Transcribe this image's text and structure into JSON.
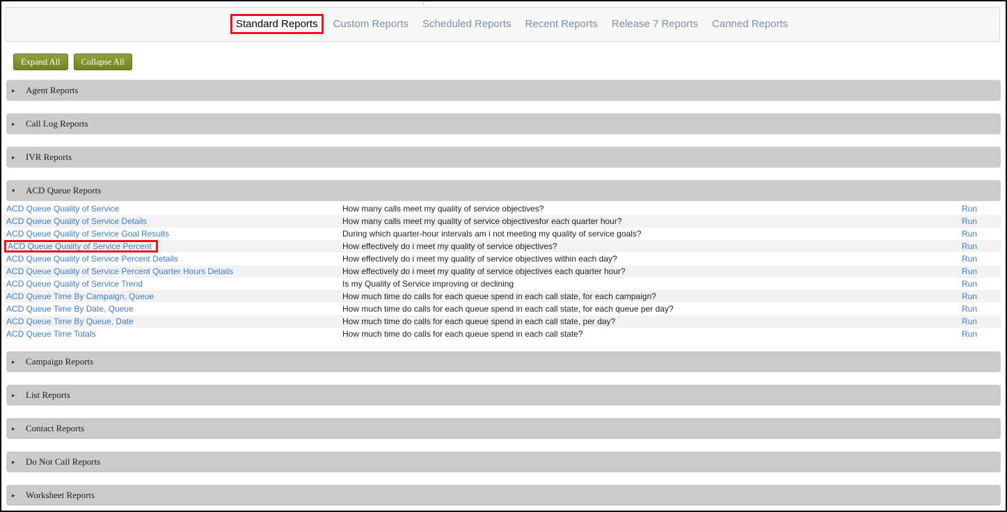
{
  "tabs": {
    "standard": "Standard Reports",
    "custom": "Custom Reports",
    "scheduled": "Scheduled Reports",
    "recent": "Recent Reports",
    "release7": "Release 7 Reports",
    "canned": "Canned Reports"
  },
  "buttons": {
    "expand_all": "Expand All",
    "collapse_all": "Collapse All"
  },
  "sections": {
    "agent": "Agent Reports",
    "call_log": "Call Log Reports",
    "ivr": "IVR Reports",
    "acd_queue": "ACD Queue Reports",
    "campaign": "Campaign Reports",
    "list": "List Reports",
    "contact": "Contact Reports",
    "do_not_call": "Do Not Call Reports",
    "worksheet": "Worksheet Reports"
  },
  "icons": {
    "collapsed": "▸",
    "expanded": "▾"
  },
  "acd_reports": [
    {
      "name": "ACD Queue Quality of Service",
      "description": "How many calls meet my quality of service objectives?",
      "action": "Run"
    },
    {
      "name": "ACD Queue Quality of Service Details",
      "description": "How many calls meet my quality of service objectivesfor each quarter hour?",
      "action": "Run"
    },
    {
      "name": "ACD Queue Quality of Service Goal Results",
      "description": "During which quarter-hour intervals am i not meeting my quality of service goals?",
      "action": "Run"
    },
    {
      "name": "ACD Queue Quality of Service Percent",
      "description": "How effectively do i meet my quality of service objectives?",
      "action": "Run"
    },
    {
      "name": "ACD Queue Quality of Service Percent Details",
      "description": "How effectively do i meet my quality of service objectives within each day?",
      "action": "Run"
    },
    {
      "name": "ACD Queue Quality of Service Percent Quarter Hours Details",
      "description": "How effectively do i meet my quality of service objectives each quarter hour?",
      "action": "Run"
    },
    {
      "name": "ACD Queue Quality of Service Trend",
      "description": "Is my Quality of Service improving or declining",
      "action": "Run"
    },
    {
      "name": "ACD Queue Time By Campaign, Queue",
      "description": "How much time do calls for each queue spend in each call state, for each campaign?",
      "action": "Run"
    },
    {
      "name": "ACD Queue Time By Date, Queue",
      "description": "How much time do calls for each queue spend in each call state, for each queue per day?",
      "action": "Run"
    },
    {
      "name": "ACD Queue Time By Queue, Date",
      "description": "How much time do calls for each queue spend in each call state, per day?",
      "action": "Run"
    },
    {
      "name": "ACD Queue Time Totals",
      "description": "How much time do calls for each queue spend in each call state?",
      "action": "Run"
    }
  ],
  "colors": {
    "highlight": "#e8141e",
    "link": "#3f7cbf",
    "button": "#7b912c",
    "section_bg": "#cbcbcb"
  }
}
